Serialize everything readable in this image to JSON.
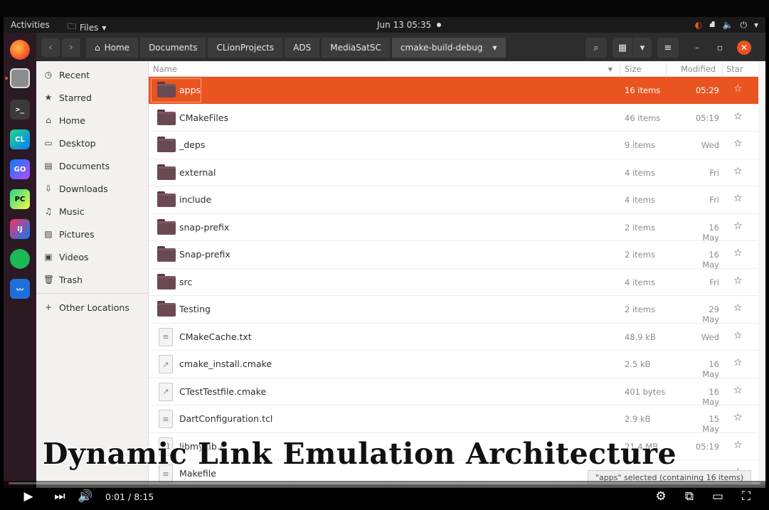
{
  "topbar": {
    "activities": "Activities",
    "app_menu": "Files",
    "clock": "Jun 13  05:35"
  },
  "window": {
    "breadcrumbs": [
      "Home",
      "Documents",
      "CLionProjects",
      "ADS",
      "MediaSatSC",
      "cmake-build-debug"
    ]
  },
  "sidebar": {
    "items": [
      {
        "label": "Recent",
        "icon": "clock-icon"
      },
      {
        "label": "Starred",
        "icon": "star-icon"
      },
      {
        "label": "Home",
        "icon": "home-icon"
      },
      {
        "label": "Desktop",
        "icon": "desktop-icon"
      },
      {
        "label": "Documents",
        "icon": "document-icon"
      },
      {
        "label": "Downloads",
        "icon": "download-icon"
      },
      {
        "label": "Music",
        "icon": "music-icon"
      },
      {
        "label": "Pictures",
        "icon": "picture-icon"
      },
      {
        "label": "Videos",
        "icon": "video-icon"
      },
      {
        "label": "Trash",
        "icon": "trash-icon"
      }
    ],
    "other_locations": "Other Locations"
  },
  "list": {
    "columns": {
      "name": "Name",
      "size": "Size",
      "modified": "Modified",
      "star": "Star"
    },
    "rows": [
      {
        "name": "apps",
        "size": "16 items",
        "modified": "05:29",
        "type": "folder",
        "selected": true
      },
      {
        "name": "CMakeFiles",
        "size": "46 items",
        "modified": "05:19",
        "type": "folder"
      },
      {
        "name": "_deps",
        "size": "9 items",
        "modified": "Wed",
        "type": "folder"
      },
      {
        "name": "external",
        "size": "4 items",
        "modified": "Fri",
        "type": "folder"
      },
      {
        "name": "include",
        "size": "4 items",
        "modified": "Fri",
        "type": "folder"
      },
      {
        "name": "snap-prefix",
        "size": "2 items",
        "modified": "16 May",
        "type": "folder"
      },
      {
        "name": "Snap-prefix",
        "size": "2 items",
        "modified": "16 May",
        "type": "folder"
      },
      {
        "name": "src",
        "size": "4 items",
        "modified": "Fri",
        "type": "folder"
      },
      {
        "name": "Testing",
        "size": "2 items",
        "modified": "29 May",
        "type": "folder"
      },
      {
        "name": "CMakeCache.txt",
        "size": "48.9 kB",
        "modified": "Wed",
        "type": "text"
      },
      {
        "name": "cmake_install.cmake",
        "size": "2.5 kB",
        "modified": "16 May",
        "type": "script"
      },
      {
        "name": "CTestTestfile.cmake",
        "size": "401 bytes",
        "modified": "16 May",
        "type": "script"
      },
      {
        "name": "DartConfiguration.tcl",
        "size": "2.9 kB",
        "modified": "15 May",
        "type": "text"
      },
      {
        "name": "libmyLib.a",
        "size": "21.4 MB",
        "modified": "05:19",
        "type": "binary"
      },
      {
        "name": "Makefile",
        "size": "",
        "modified": "",
        "type": "text"
      }
    ]
  },
  "status": "\"apps\" selected  (containing 16 items)",
  "overlay_title": "Dynamic Link Emulation Architecture",
  "player": {
    "time": "0:01 / 8:15",
    "progress": 0.002
  }
}
